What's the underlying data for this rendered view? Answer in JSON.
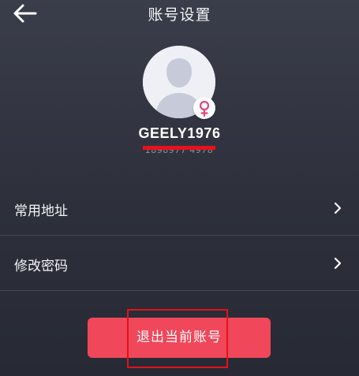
{
  "header": {
    "back_icon": "arrow-left-icon",
    "title": "账号设置"
  },
  "profile": {
    "avatar_icon": "default-user-avatar",
    "gender_icon": "female-symbol-icon",
    "username": "GEELY1976",
    "phone_masked": "1898977 4978"
  },
  "menu": {
    "items": [
      {
        "label": "常用地址",
        "chevron_icon": "chevron-right-icon"
      },
      {
        "label": "修改密码",
        "chevron_icon": "chevron-right-icon"
      }
    ]
  },
  "logout": {
    "label": "退出当前账号"
  },
  "colors": {
    "background_top": "#3a3d4a",
    "background_bottom": "#272a34",
    "accent": "#f0475a",
    "female_pink": "#e6447a",
    "redaction_red": "#e8111c",
    "annotation_red": "#e41218"
  }
}
